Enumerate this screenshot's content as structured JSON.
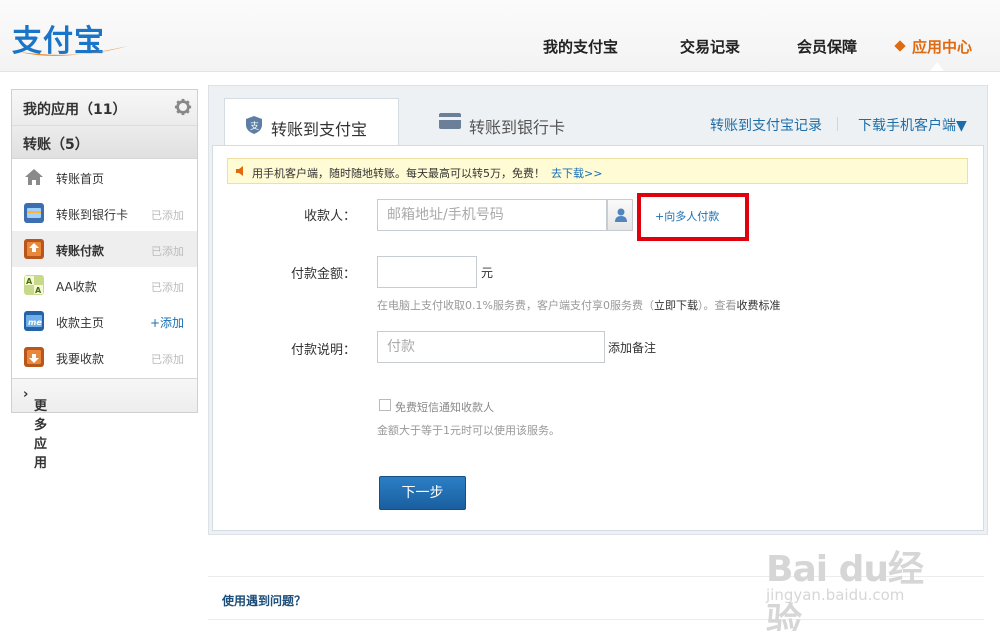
{
  "brand": {
    "logo_text": "支付宝"
  },
  "nav": {
    "items": [
      {
        "label": "我的支付宝"
      },
      {
        "label": "交易记录"
      },
      {
        "label": "会员保障"
      },
      {
        "label": "应用中心",
        "active": true
      }
    ]
  },
  "sidebar": {
    "title": "我的应用（11）",
    "group": "转账（5）",
    "items": [
      {
        "label": "转账首页",
        "action": "",
        "icon": "home-icon"
      },
      {
        "label": "转账到银行卡",
        "action": "已添加",
        "icon": "bank-card-icon"
      },
      {
        "label": "转账付款",
        "action": "已添加",
        "icon": "transfer-pay-icon",
        "selected": true
      },
      {
        "label": "AA收款",
        "action": "已添加",
        "icon": "aa-collect-icon"
      },
      {
        "label": "收款主页",
        "action": "+添加",
        "icon": "collect-home-icon",
        "addable": true
      },
      {
        "label": "我要收款",
        "action": "已添加",
        "icon": "request-money-icon"
      }
    ],
    "more": "更多应用"
  },
  "tabs": {
    "active": "转账到支付宝",
    "bank": "转账到银行卡",
    "records_link": "转账到支付宝记录",
    "download_link": "下载手机客户端▼"
  },
  "notice": {
    "text": "用手机客户端，随时随地转账。每天最高可以转5万，免费！",
    "link": "去下载>>"
  },
  "form": {
    "payee_label": "收款人：",
    "payee_placeholder": "邮箱地址/手机号码",
    "multi_link": "+向多人付款",
    "amount_label": "付款金额：",
    "amount_value": "",
    "amount_unit": "元",
    "fee_hint_1": "在电脑上支付收取0.1%服务费，客户端支付享0服务费（",
    "fee_hint_link": "立即下载",
    "fee_hint_2": "）。查看",
    "fee_hint_link2": "收费标准",
    "memo_label": "付款说明：",
    "memo_placeholder": "付款",
    "memo_add": "添加备注",
    "sms_label": "免费短信通知收款人",
    "sms_hint": "金额大于等于1元时可以使用该服务。",
    "next_button": "下一步"
  },
  "faq": {
    "label": "使用遇到问题？"
  },
  "watermark": {
    "main": "Bai du经验",
    "sub": "jingyan.baidu.com"
  },
  "colors": {
    "accent": "#e06a10",
    "link": "#1a6fb3",
    "button": "#1f6fb5",
    "highlight_box": "#e0000e"
  }
}
